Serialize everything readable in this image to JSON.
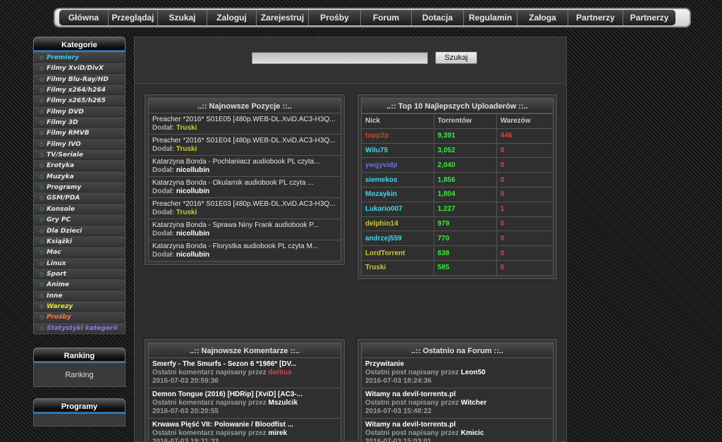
{
  "nav": [
    "Główna",
    "Przeglądaj",
    "Szukaj",
    "Zaloguj",
    "Zarejestruj",
    "Prośby",
    "Forum",
    "Dotacja",
    "Regulamin",
    "Załoga",
    "Partnerzy",
    "Partnerzy"
  ],
  "sidebar": {
    "categories_title": "Kategorie",
    "categories": [
      {
        "label": "Premiery",
        "color": "#3fc7e6"
      },
      {
        "label": "Filmy XviD/DivX",
        "color": "#e6e6e6"
      },
      {
        "label": "Filmy Blu-Ray/HD",
        "color": "#e6e6e6"
      },
      {
        "label": "Filmy x264/h264",
        "color": "#e6e6e6"
      },
      {
        "label": "Filmy x265/h265",
        "color": "#e6e6e6"
      },
      {
        "label": "Filmy DVD",
        "color": "#e6e6e6"
      },
      {
        "label": "Filmy 3D",
        "color": "#e6e6e6"
      },
      {
        "label": "Filmy RMVB",
        "color": "#e6e6e6"
      },
      {
        "label": "Filmy IVO",
        "color": "#e6e6e6"
      },
      {
        "label": "TV/Seriale",
        "color": "#e6e6e6"
      },
      {
        "label": "Erotyka",
        "color": "#e6e6e6"
      },
      {
        "label": "Muzyka",
        "color": "#e6e6e6"
      },
      {
        "label": "Programy",
        "color": "#e6e6e6"
      },
      {
        "label": "GSM/PDA",
        "color": "#e6e6e6"
      },
      {
        "label": "Konsole",
        "color": "#e6e6e6"
      },
      {
        "label": "Gry PC",
        "color": "#e6e6e6"
      },
      {
        "label": "Dla Dzieci",
        "color": "#e6e6e6"
      },
      {
        "label": "Książki",
        "color": "#e6e6e6"
      },
      {
        "label": "Mac",
        "color": "#e6e6e6"
      },
      {
        "label": "Linux",
        "color": "#e6e6e6"
      },
      {
        "label": "Sport",
        "color": "#e6e6e6"
      },
      {
        "label": "Anime",
        "color": "#e6e6e6"
      },
      {
        "label": "Inne",
        "color": "#e6e6e6"
      },
      {
        "label": "Warezy",
        "color": "#e6e63f"
      },
      {
        "label": "Prośby",
        "color": "#ff7a3f"
      },
      {
        "label": "Statystyki kategorii",
        "color": "#8a7ae6"
      }
    ],
    "ranking_title": "Ranking",
    "ranking_link": "Ranking",
    "programy_title": "Programy"
  },
  "search": {
    "button": "Szukaj",
    "value": ""
  },
  "newest": {
    "title": "..:: Najnowsze Pozycje ::..",
    "added_label": "Dodał:",
    "items": [
      {
        "title": "Preacher *2016* S01E05 [480p.WEB-DL.XviD.AC3-H3Q...",
        "user": "Truski",
        "color": "#c8c83a"
      },
      {
        "title": "Preacher *2016* S01E04 [480p.WEB-DL.XviD.AC3-H3Q...",
        "user": "Truski",
        "color": "#c8c83a"
      },
      {
        "title": "Katarzyna Bonda - Pochlaniacz audiobook PL czyta...",
        "user": "nicollubin",
        "color": "#ffffff"
      },
      {
        "title": "Katarzyna Bonda - Okularnik audiobook PL czyta ...",
        "user": "nicollubin",
        "color": "#ffffff"
      },
      {
        "title": "Preacher *2016* S01E03 [480p.WEB-DL.XviD.AC3-H3Q...",
        "user": "Truski",
        "color": "#c8c83a"
      },
      {
        "title": "Katarzyna Bonda - Sprawa Niny Frank audiobook P...",
        "user": "nicollubin",
        "color": "#ffffff"
      },
      {
        "title": "Katarzyna Bonda - Florystka audiobook PL czyta M...",
        "user": "nicollubin",
        "color": "#ffffff"
      }
    ]
  },
  "top": {
    "title": "..:: Top 10 Najlepszych Uploaderów ::..",
    "headers": [
      "Nick",
      "Torrentów",
      "Warezów"
    ],
    "rows": [
      {
        "nick": "topp2p",
        "nick_color": "#c44a1a",
        "torrents": "9,391",
        "warez": "446"
      },
      {
        "nick": "Wilu75",
        "nick_color": "#3fd6f0",
        "torrents": "3,052",
        "warez": "0"
      },
      {
        "nick": "ywgyvidp",
        "nick_color": "#6b6bf0",
        "torrents": "2,040",
        "warez": "0"
      },
      {
        "nick": "siemekos",
        "nick_color": "#3fd6f0",
        "torrents": "1,856",
        "warez": "0"
      },
      {
        "nick": "Mozaykin",
        "nick_color": "#3fd6f0",
        "torrents": "1,804",
        "warez": "0"
      },
      {
        "nick": "Lukario007",
        "nick_color": "#3fd6f0",
        "torrents": "1,227",
        "warez": "1"
      },
      {
        "nick": "delphin14",
        "nick_color": "#c8c83a",
        "torrents": "979",
        "warez": "0"
      },
      {
        "nick": "andrzej559",
        "nick_color": "#3fd6f0",
        "torrents": "770",
        "warez": "0"
      },
      {
        "nick": "LordTorrent",
        "nick_color": "#c8c83a",
        "torrents": "638",
        "warez": "0"
      },
      {
        "nick": "Truski",
        "nick_color": "#c8c83a",
        "torrents": "585",
        "warez": "0"
      }
    ],
    "torrent_color": "#3fe63f",
    "warez_color": "#e63f3f"
  },
  "comments": {
    "title": "..:: Najnowsze Komentarze ::..",
    "items": [
      {
        "title": "Smerfy - The Smurfs - Sezon 6 *1986* [DV...",
        "prefix": "Ostatni komentarz napisany przez",
        "user": "derbus",
        "user_color": "#e63f3f",
        "date": "2016-07-03 20:59:36"
      },
      {
        "title": "Demon Tongue (2016) [HDRip] [XviD] [AC3-...",
        "prefix": "Ostatni komentarz napisany przez",
        "user": "Mszulcik",
        "user_color": "#ffffff",
        "date": "2016-07-03 20:20:55"
      },
      {
        "title": "Krwawa Pięść VII: Polowanie / Bloodfist ...",
        "prefix": "Ostatni komentarz napisany przez",
        "user": "mirek",
        "user_color": "#ffffff",
        "date": "2016-07-03 19:31:33"
      }
    ]
  },
  "forum": {
    "title": "..:: Ostatnio na Forum ::..",
    "items": [
      {
        "title": "Przywitanie",
        "prefix": "Ostatni post napisany przez",
        "user": "Leon50",
        "user_color": "#ffffff",
        "date": "2016-07-03 18:24:36"
      },
      {
        "title": "Witamy na devil-torrents.pl",
        "prefix": "Ostatni post napisany przez",
        "user": "Witcher",
        "user_color": "#ffffff",
        "date": "2016-07-03 15:48:22"
      },
      {
        "title": "Witamy na devil-torrents.pl",
        "prefix": "Ostatni post napisany przez",
        "user": "Kmicic",
        "user_color": "#ffffff",
        "date": "2016-07-03 15:03:01"
      }
    ]
  }
}
